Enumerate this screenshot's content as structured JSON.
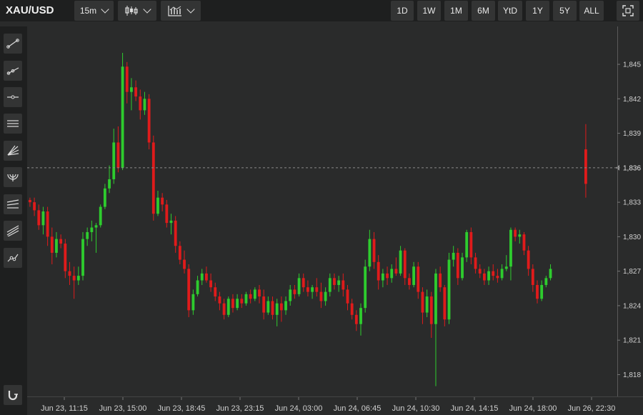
{
  "header": {
    "symbol": "XAU/USD",
    "interval": "15m",
    "ranges": [
      "1D",
      "1W",
      "1M",
      "6M",
      "YtD",
      "1Y",
      "5Y",
      "ALL"
    ]
  },
  "colors": {
    "up": "#2ecc2e",
    "down": "#e01b1b",
    "background": "#2a2b2b",
    "toolbar": "#1e1f1f",
    "button": "#333434"
  },
  "toolbar": {
    "icons": [
      "trend-line-icon",
      "ray-icon",
      "horizontal-line-icon",
      "parallel-channel-icon",
      "fan-icon",
      "arc-icon",
      "fib-retracement-icon",
      "pitchfork-icon",
      "path-icon",
      "magnet-icon"
    ]
  },
  "chart_data": {
    "type": "candlestick",
    "yticks": [
      "1,845",
      "1,842",
      "1,839",
      "1,836",
      "1,833",
      "1,830",
      "1,827",
      "1,824",
      "1,821",
      "1,818"
    ],
    "ytick_values": [
      1845,
      1842,
      1839,
      1836,
      1833,
      1830,
      1827,
      1824,
      1821,
      1818
    ],
    "ylim": [
      1816.6,
      1847.8
    ],
    "last_price_label": "1,836",
    "last_price": 1836.0,
    "xticks": [
      "Jun 23, 11:15",
      "Jun 23, 15:00",
      "Jun 23, 18:45",
      "Jun 23, 23:15",
      "Jun 24, 03:00",
      "Jun 24, 06:45",
      "Jun 24, 10:30",
      "Jun 24, 14:15",
      "Jun 24, 18:00",
      "Jun 26, 22:30"
    ],
    "candles": [
      [
        1833.2,
        1833.4,
        1832.6,
        1833.0
      ],
      [
        1833.0,
        1833.4,
        1831.8,
        1832.3
      ],
      [
        1832.3,
        1832.8,
        1830.6,
        1831.0
      ],
      [
        1831.0,
        1832.6,
        1830.2,
        1832.2
      ],
      [
        1832.2,
        1832.6,
        1829.2,
        1830.0
      ],
      [
        1830.0,
        1830.8,
        1827.6,
        1828.6
      ],
      [
        1828.6,
        1830.4,
        1828.2,
        1829.8
      ],
      [
        1829.8,
        1830.2,
        1829.0,
        1829.4
      ],
      [
        1829.4,
        1829.8,
        1826.4,
        1827.0
      ],
      [
        1827.0,
        1827.8,
        1825.8,
        1826.6
      ],
      [
        1826.6,
        1827.4,
        1824.6,
        1826.2
      ],
      [
        1826.2,
        1827.4,
        1825.8,
        1826.6
      ],
      [
        1826.6,
        1830.4,
        1826.2,
        1829.8
      ],
      [
        1829.8,
        1830.8,
        1829.2,
        1830.4
      ],
      [
        1830.4,
        1831.4,
        1829.6,
        1830.8
      ],
      [
        1830.8,
        1831.2,
        1828.6,
        1831.0
      ],
      [
        1831.0,
        1832.8,
        1830.8,
        1832.6
      ],
      [
        1832.6,
        1834.6,
        1832.4,
        1834.2
      ],
      [
        1834.2,
        1836.2,
        1833.8,
        1835.0
      ],
      [
        1835.0,
        1839.4,
        1834.6,
        1838.2
      ],
      [
        1838.2,
        1839.6,
        1835.6,
        1836.0
      ],
      [
        1836.0,
        1846.0,
        1835.8,
        1844.8
      ],
      [
        1844.8,
        1845.2,
        1841.6,
        1842.6
      ],
      [
        1842.6,
        1843.8,
        1841.0,
        1843.0
      ],
      [
        1843.0,
        1843.6,
        1841.8,
        1842.2
      ],
      [
        1842.2,
        1842.8,
        1840.2,
        1841.0
      ],
      [
        1841.0,
        1842.6,
        1840.6,
        1842.0
      ],
      [
        1842.0,
        1842.4,
        1837.6,
        1838.2
      ],
      [
        1838.2,
        1838.8,
        1831.4,
        1832.0
      ],
      [
        1832.0,
        1834.0,
        1831.8,
        1833.4
      ],
      [
        1833.4,
        1833.8,
        1832.2,
        1832.8
      ],
      [
        1832.8,
        1833.2,
        1830.8,
        1831.2
      ],
      [
        1831.2,
        1832.0,
        1830.2,
        1831.4
      ],
      [
        1831.4,
        1831.8,
        1828.6,
        1829.2
      ],
      [
        1829.2,
        1829.6,
        1827.6,
        1828.0
      ],
      [
        1828.0,
        1828.8,
        1826.8,
        1827.2
      ],
      [
        1827.2,
        1827.6,
        1823.0,
        1823.6
      ],
      [
        1823.6,
        1825.4,
        1823.2,
        1825.0
      ],
      [
        1825.0,
        1826.6,
        1824.8,
        1826.2
      ],
      [
        1826.2,
        1827.2,
        1825.8,
        1826.8
      ],
      [
        1826.8,
        1827.4,
        1826.0,
        1826.2
      ],
      [
        1826.2,
        1826.8,
        1825.2,
        1825.6
      ],
      [
        1825.6,
        1826.0,
        1824.4,
        1824.8
      ],
      [
        1824.8,
        1825.2,
        1823.6,
        1824.2
      ],
      [
        1824.2,
        1824.6,
        1822.8,
        1823.2
      ],
      [
        1823.2,
        1824.8,
        1823.0,
        1824.6
      ],
      [
        1824.6,
        1825.0,
        1823.4,
        1823.8
      ],
      [
        1823.8,
        1825.0,
        1823.6,
        1824.6
      ],
      [
        1824.6,
        1825.0,
        1823.8,
        1824.2
      ],
      [
        1824.2,
        1825.2,
        1824.0,
        1825.0
      ],
      [
        1825.0,
        1825.4,
        1824.2,
        1824.6
      ],
      [
        1824.6,
        1825.6,
        1824.4,
        1825.4
      ],
      [
        1825.4,
        1825.8,
        1824.2,
        1824.8
      ],
      [
        1824.8,
        1825.4,
        1822.8,
        1823.4
      ],
      [
        1823.4,
        1824.8,
        1823.2,
        1824.4
      ],
      [
        1824.4,
        1824.8,
        1822.8,
        1823.2
      ],
      [
        1823.2,
        1824.6,
        1822.2,
        1824.2
      ],
      [
        1824.2,
        1824.8,
        1822.6,
        1823.6
      ],
      [
        1823.6,
        1824.8,
        1823.2,
        1824.4
      ],
      [
        1824.4,
        1825.8,
        1824.0,
        1825.4
      ],
      [
        1825.4,
        1825.8,
        1824.6,
        1825.0
      ],
      [
        1825.0,
        1826.8,
        1824.8,
        1826.4
      ],
      [
        1826.4,
        1826.8,
        1825.2,
        1825.6
      ],
      [
        1825.6,
        1826.2,
        1824.8,
        1825.2
      ],
      [
        1825.2,
        1825.8,
        1824.6,
        1825.6
      ],
      [
        1825.6,
        1826.4,
        1824.8,
        1825.2
      ],
      [
        1825.2,
        1826.0,
        1823.8,
        1824.4
      ],
      [
        1824.4,
        1825.6,
        1824.0,
        1825.2
      ],
      [
        1825.2,
        1826.8,
        1824.8,
        1826.4
      ],
      [
        1826.4,
        1826.8,
        1825.4,
        1825.8
      ],
      [
        1825.8,
        1826.6,
        1825.2,
        1826.2
      ],
      [
        1826.2,
        1826.8,
        1824.8,
        1825.4
      ],
      [
        1825.4,
        1825.8,
        1823.6,
        1824.2
      ],
      [
        1824.2,
        1824.6,
        1822.8,
        1823.2
      ],
      [
        1823.2,
        1823.6,
        1821.8,
        1822.4
      ],
      [
        1822.4,
        1824.2,
        1821.4,
        1823.8
      ],
      [
        1823.8,
        1828.0,
        1823.4,
        1827.4
      ],
      [
        1827.4,
        1830.6,
        1827.0,
        1829.8
      ],
      [
        1829.8,
        1830.4,
        1827.2,
        1827.8
      ],
      [
        1827.8,
        1828.4,
        1825.4,
        1826.2
      ],
      [
        1826.2,
        1827.2,
        1825.6,
        1826.8
      ],
      [
        1826.8,
        1827.4,
        1825.8,
        1826.4
      ],
      [
        1826.4,
        1827.6,
        1826.0,
        1827.2
      ],
      [
        1827.2,
        1828.2,
        1826.6,
        1826.8
      ],
      [
        1826.8,
        1829.2,
        1826.6,
        1828.8
      ],
      [
        1828.8,
        1829.0,
        1825.8,
        1826.4
      ],
      [
        1826.4,
        1826.8,
        1825.4,
        1825.8
      ],
      [
        1825.8,
        1827.8,
        1825.6,
        1827.4
      ],
      [
        1827.4,
        1827.8,
        1824.6,
        1825.2
      ],
      [
        1825.2,
        1825.6,
        1822.4,
        1823.4
      ],
      [
        1823.4,
        1825.4,
        1823.0,
        1824.8
      ],
      [
        1824.8,
        1825.2,
        1821.2,
        1822.4
      ],
      [
        1822.4,
        1827.2,
        1817.0,
        1826.8
      ],
      [
        1826.8,
        1827.4,
        1825.2,
        1825.6
      ],
      [
        1825.6,
        1825.8,
        1822.2,
        1822.8
      ],
      [
        1822.8,
        1828.6,
        1822.4,
        1828.0
      ],
      [
        1828.0,
        1829.2,
        1827.4,
        1828.6
      ],
      [
        1828.6,
        1829.0,
        1825.8,
        1826.4
      ],
      [
        1826.4,
        1828.6,
        1826.2,
        1828.2
      ],
      [
        1828.2,
        1830.6,
        1827.8,
        1830.4
      ],
      [
        1830.4,
        1830.8,
        1827.6,
        1828.2
      ],
      [
        1828.2,
        1828.6,
        1826.8,
        1827.2
      ],
      [
        1827.2,
        1827.6,
        1826.4,
        1826.8
      ],
      [
        1826.8,
        1827.2,
        1825.8,
        1826.2
      ],
      [
        1826.2,
        1827.4,
        1825.8,
        1827.0
      ],
      [
        1827.0,
        1827.6,
        1826.2,
        1826.6
      ],
      [
        1826.6,
        1827.2,
        1826.0,
        1826.4
      ],
      [
        1826.4,
        1827.6,
        1826.2,
        1827.2
      ],
      [
        1827.2,
        1828.4,
        1827.0,
        1827.4
      ],
      [
        1827.4,
        1830.8,
        1826.2,
        1830.6
      ],
      [
        1830.6,
        1830.8,
        1829.6,
        1830.0
      ],
      [
        1830.0,
        1830.6,
        1829.4,
        1830.2
      ],
      [
        1830.2,
        1830.4,
        1828.4,
        1828.8
      ],
      [
        1828.8,
        1829.2,
        1826.6,
        1827.2
      ],
      [
        1827.2,
        1827.6,
        1825.2,
        1825.8
      ],
      [
        1825.8,
        1826.2,
        1824.2,
        1824.6
      ],
      [
        1824.6,
        1826.2,
        1824.4,
        1825.8
      ],
      [
        1825.8,
        1826.6,
        1825.6,
        1826.4
      ],
      [
        1826.4,
        1827.6,
        1826.2,
        1827.2
      ],
      [
        1837.6,
        1839.8,
        1833.4,
        1834.6
      ]
    ]
  }
}
